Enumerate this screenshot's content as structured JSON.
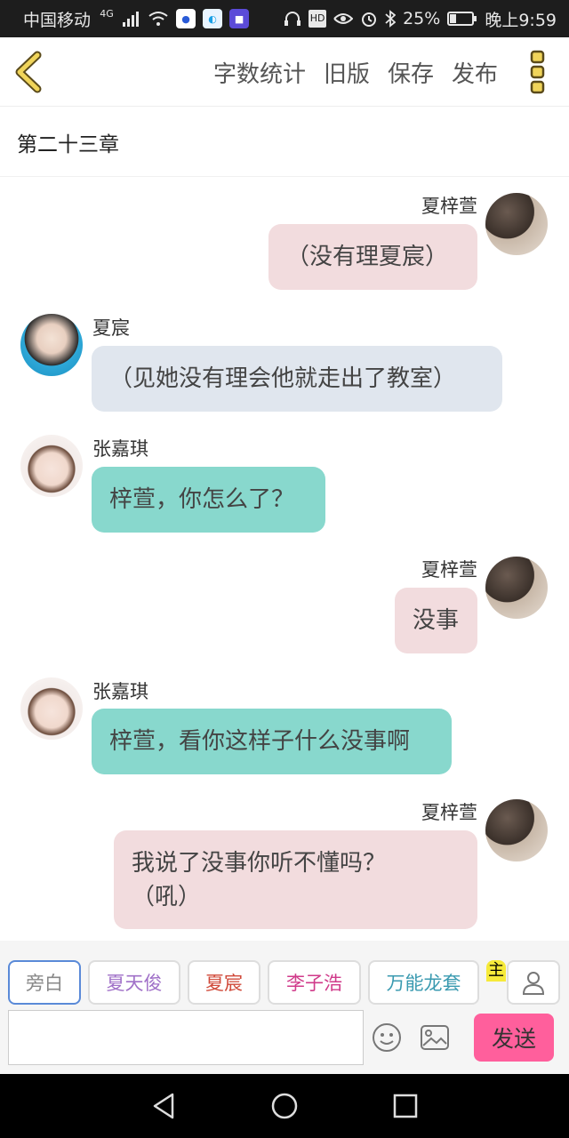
{
  "status_bar": {
    "carrier": "中国移动",
    "network": "4G",
    "battery": "25%",
    "time": "晚上9:59",
    "icons": [
      "signal-icon",
      "wifi-icon",
      "baidu-app-icon",
      "browser-app-icon",
      "shop-app-icon",
      "headphones-icon",
      "hd-icon",
      "eye-icon",
      "alarm-icon",
      "bluetooth-icon",
      "battery-icon"
    ]
  },
  "toolbar": {
    "word_count": "字数统计",
    "old_version": "旧版",
    "save": "保存",
    "publish": "发布",
    "accent_color": "#e8c84a"
  },
  "chapter_title": "第二十三章",
  "messages": [
    {
      "side": "right",
      "name": "夏梓萱",
      "text": "（没有理夏宸）",
      "bubble_color": "#f2dcde"
    },
    {
      "side": "left",
      "name": "夏宸",
      "text": "（见她没有理会他就走出了教室）",
      "bubble_color": "#e0e6ee"
    },
    {
      "side": "left",
      "name": "张嘉琪",
      "text": "梓萱，你怎么了？",
      "bubble_color": "#88d8cd"
    },
    {
      "side": "right",
      "name": "夏梓萱",
      "text": "没事",
      "bubble_color": "#f2dcde"
    },
    {
      "side": "left",
      "name": "张嘉琪",
      "text": "梓萱，看你这样子什么没事啊",
      "bubble_color": "#88d8cd"
    },
    {
      "side": "right",
      "name": "夏梓萱",
      "text_line1": "我说了没事你听不懂吗？",
      "text_line2": "（吼）",
      "bubble_color": "#f2dcde"
    }
  ],
  "characters": [
    {
      "label": "旁白",
      "color": "#888888",
      "border": "#5a8ad8"
    },
    {
      "label": "夏天俊",
      "color": "#a070c8",
      "border": "#dddddd"
    },
    {
      "label": "夏宸",
      "color": "#d04a3a",
      "border": "#dddddd"
    },
    {
      "label": "李子浩",
      "color": "#d03a8a",
      "border": "#dddddd"
    },
    {
      "label": "万能龙套",
      "color": "#3a9ab0",
      "border": "#dddddd"
    }
  ],
  "main_character_tag": "主",
  "send_label": "发送",
  "input_value": ""
}
